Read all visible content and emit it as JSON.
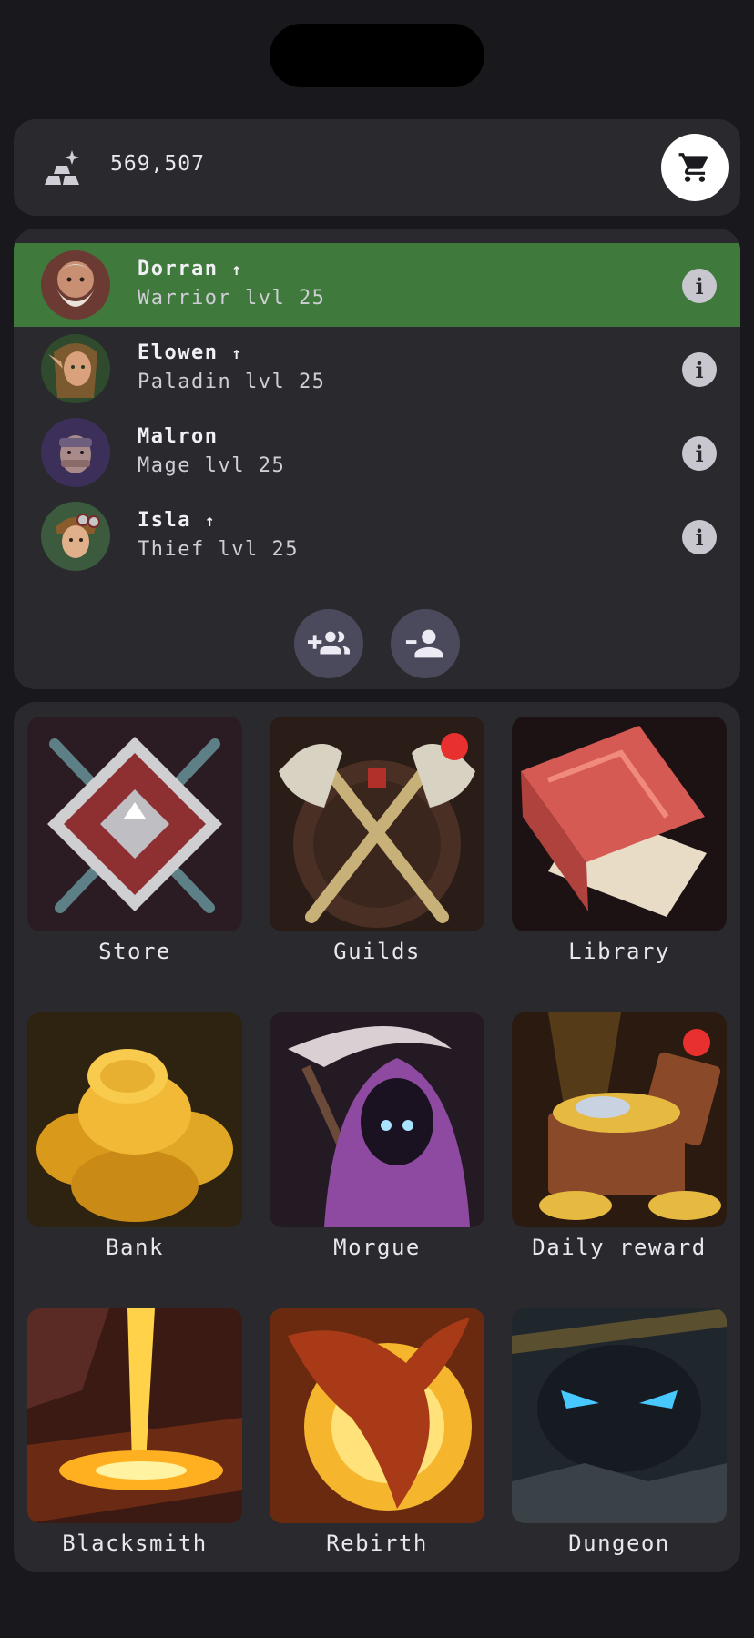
{
  "currency": {
    "icon": "gold-ingots-sparkle-icon",
    "amount": "569,507"
  },
  "cart": {
    "icon": "shopping-cart-icon"
  },
  "party": {
    "members": [
      {
        "name": "Dorran",
        "arrow": "↑",
        "class_level": "Warrior lvl 25",
        "selected": true
      },
      {
        "name": "Elowen",
        "arrow": "↑",
        "class_level": "Paladin lvl 25",
        "selected": false
      },
      {
        "name": "Malron",
        "arrow": "",
        "class_level": "Mage lvl 25",
        "selected": false
      },
      {
        "name": "Isla",
        "arrow": "↑",
        "class_level": "Thief lvl 25",
        "selected": false
      }
    ],
    "info_glyph": "i",
    "add_icon": "add-group-icon",
    "remove_icon": "remove-person-icon"
  },
  "menu": {
    "tiles": [
      {
        "label": "Store",
        "icon": "crossed-swords-shield-icon",
        "notification": false
      },
      {
        "label": "Guilds",
        "icon": "crossed-axes-icon",
        "notification": true
      },
      {
        "label": "Library",
        "icon": "red-book-icon",
        "notification": false
      },
      {
        "label": "Bank",
        "icon": "gold-coins-pile-icon",
        "notification": false
      },
      {
        "label": "Morgue",
        "icon": "reaper-icon",
        "notification": false
      },
      {
        "label": "Daily reward",
        "icon": "treasure-chest-icon",
        "notification": true
      },
      {
        "label": "Blacksmith",
        "icon": "molten-metal-icon",
        "notification": false
      },
      {
        "label": "Rebirth",
        "icon": "phoenix-icon",
        "notification": false
      },
      {
        "label": "Dungeon",
        "icon": "glowing-eyes-monster-icon",
        "notification": false
      }
    ]
  },
  "colors": {
    "background": "#19181d",
    "panel": "#2a2a2e",
    "selected_row": "#3f7a3c",
    "notification": "#e8312f"
  }
}
